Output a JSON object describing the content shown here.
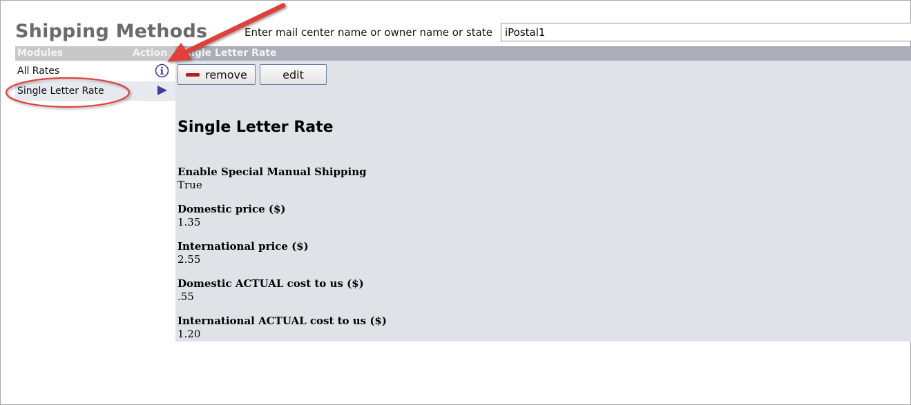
{
  "page": {
    "title": "Shipping Methods"
  },
  "search": {
    "label": "Enter mail center name or owner name or state",
    "value": "iPostal1"
  },
  "sidebar": {
    "header_modules": "Modules",
    "header_action": "Action",
    "items": [
      {
        "label": "All Rates",
        "icon": "info-icon"
      },
      {
        "label": "Single Letter Rate",
        "icon": "play-icon"
      }
    ]
  },
  "detail": {
    "header": "Single Letter Rate",
    "remove_label": "remove",
    "edit_label": "edit",
    "title": "Single Letter Rate",
    "fields": [
      {
        "label": "Enable Special Manual Shipping",
        "value": "True"
      },
      {
        "label": "Domestic price ($)",
        "value": "1.35"
      },
      {
        "label": "International price ($)",
        "value": "2.55"
      },
      {
        "label": "Domestic ACTUAL cost to us ($)",
        "value": ".55"
      },
      {
        "label": "International ACTUAL cost to us ($)",
        "value": "1.20"
      }
    ]
  },
  "colors": {
    "title": "#6b6b6b",
    "sidebar_header": "#c8c8c8",
    "detail_header": "#a9aeb8",
    "panel": "#dfe3e8",
    "selected_row": "#e6e9ee",
    "annotation": "#e0403a",
    "icon": "#3f3d9e"
  }
}
